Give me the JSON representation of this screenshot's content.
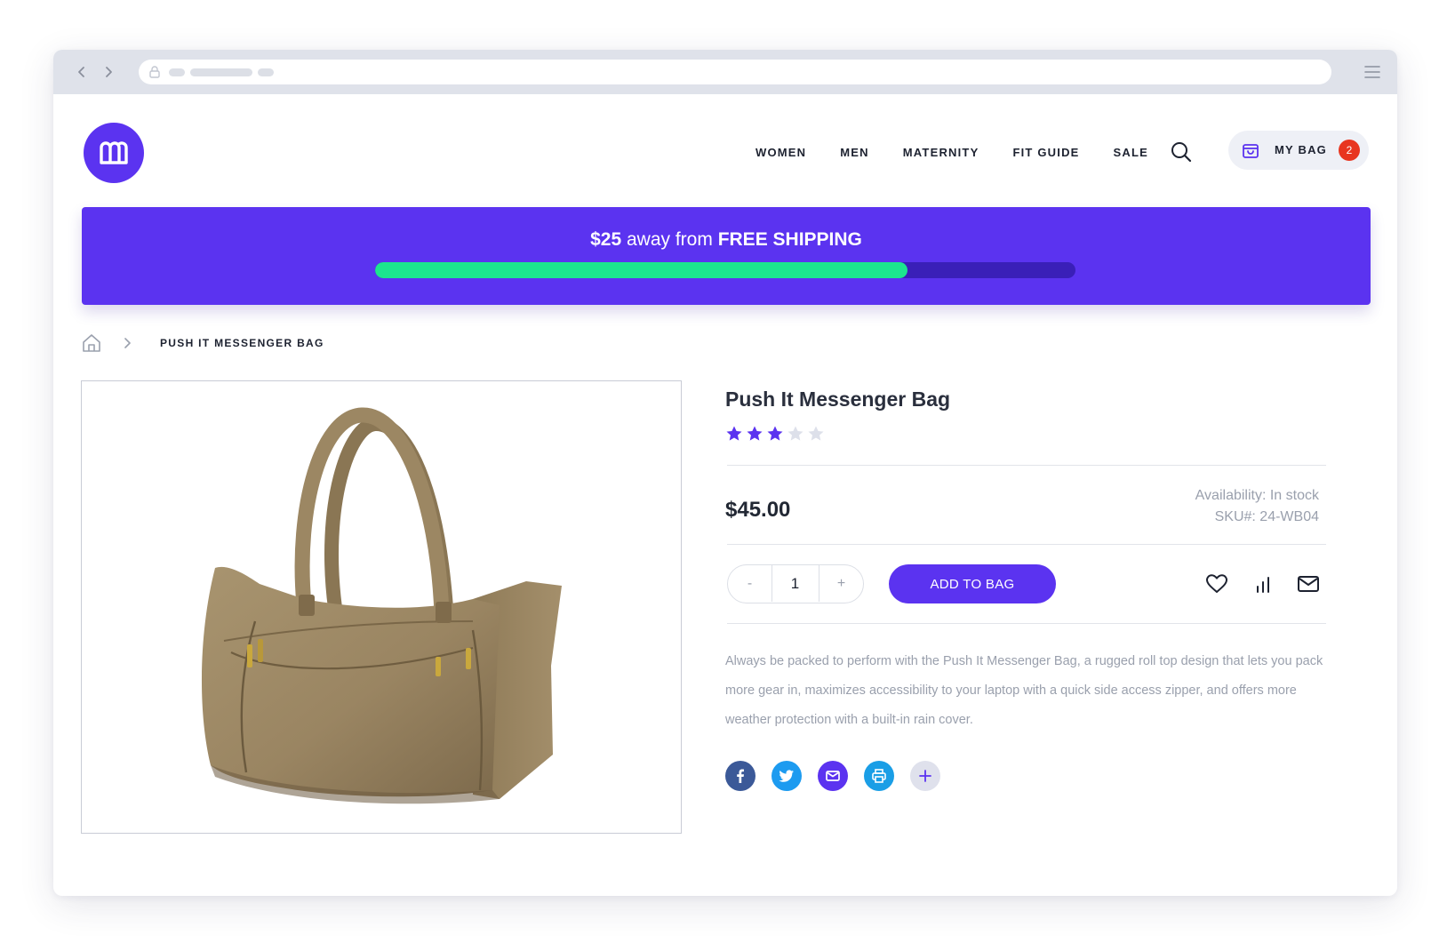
{
  "nav": {
    "items": [
      {
        "label": "WOMEN"
      },
      {
        "label": "MEN"
      },
      {
        "label": "MATERNITY"
      },
      {
        "label": "FIT GUIDE"
      },
      {
        "label": "SALE"
      }
    ],
    "bag_label": "MY BAG",
    "bag_count": "2"
  },
  "shipping": {
    "amount": "$25",
    "middle": " away from ",
    "emphasis": "FREE SHIPPING",
    "progress_fraction": 0.76,
    "fill_color": "#1ce58f",
    "track_color": "#3a1fb8"
  },
  "breadcrumb": {
    "current": "PUSH IT MESSENGER BAG"
  },
  "product": {
    "title": "Push It Messenger Bag",
    "rating": 3,
    "rating_max": 5,
    "price": "$45.00",
    "availability": "Availability: In stock",
    "sku": "SKU#: 24-WB04",
    "quantity": "1",
    "qty_minus": "-",
    "qty_plus": "+",
    "add_label": "ADD TO BAG",
    "description": "Always be packed to perform with the Push It Messenger Bag, a rugged roll top design that lets you pack more gear in, maximizes accessibility to your laptop with a quick side access zipper, and offers more weather protection with a built-in rain cover."
  },
  "theme": {
    "accent": "#5b33f0",
    "badge": "#e8351f",
    "star_inactive": "#dde0ea"
  },
  "icons": {
    "logo": "logo-m-icon",
    "search": "search-icon",
    "bag": "shopping-bag-icon",
    "home": "home-icon",
    "wishlist": "heart-icon",
    "compare": "bar-chart-icon",
    "email": "mail-icon",
    "share": [
      "facebook-icon",
      "twitter-icon",
      "email-share-icon",
      "print-icon",
      "plus-icon"
    ]
  }
}
